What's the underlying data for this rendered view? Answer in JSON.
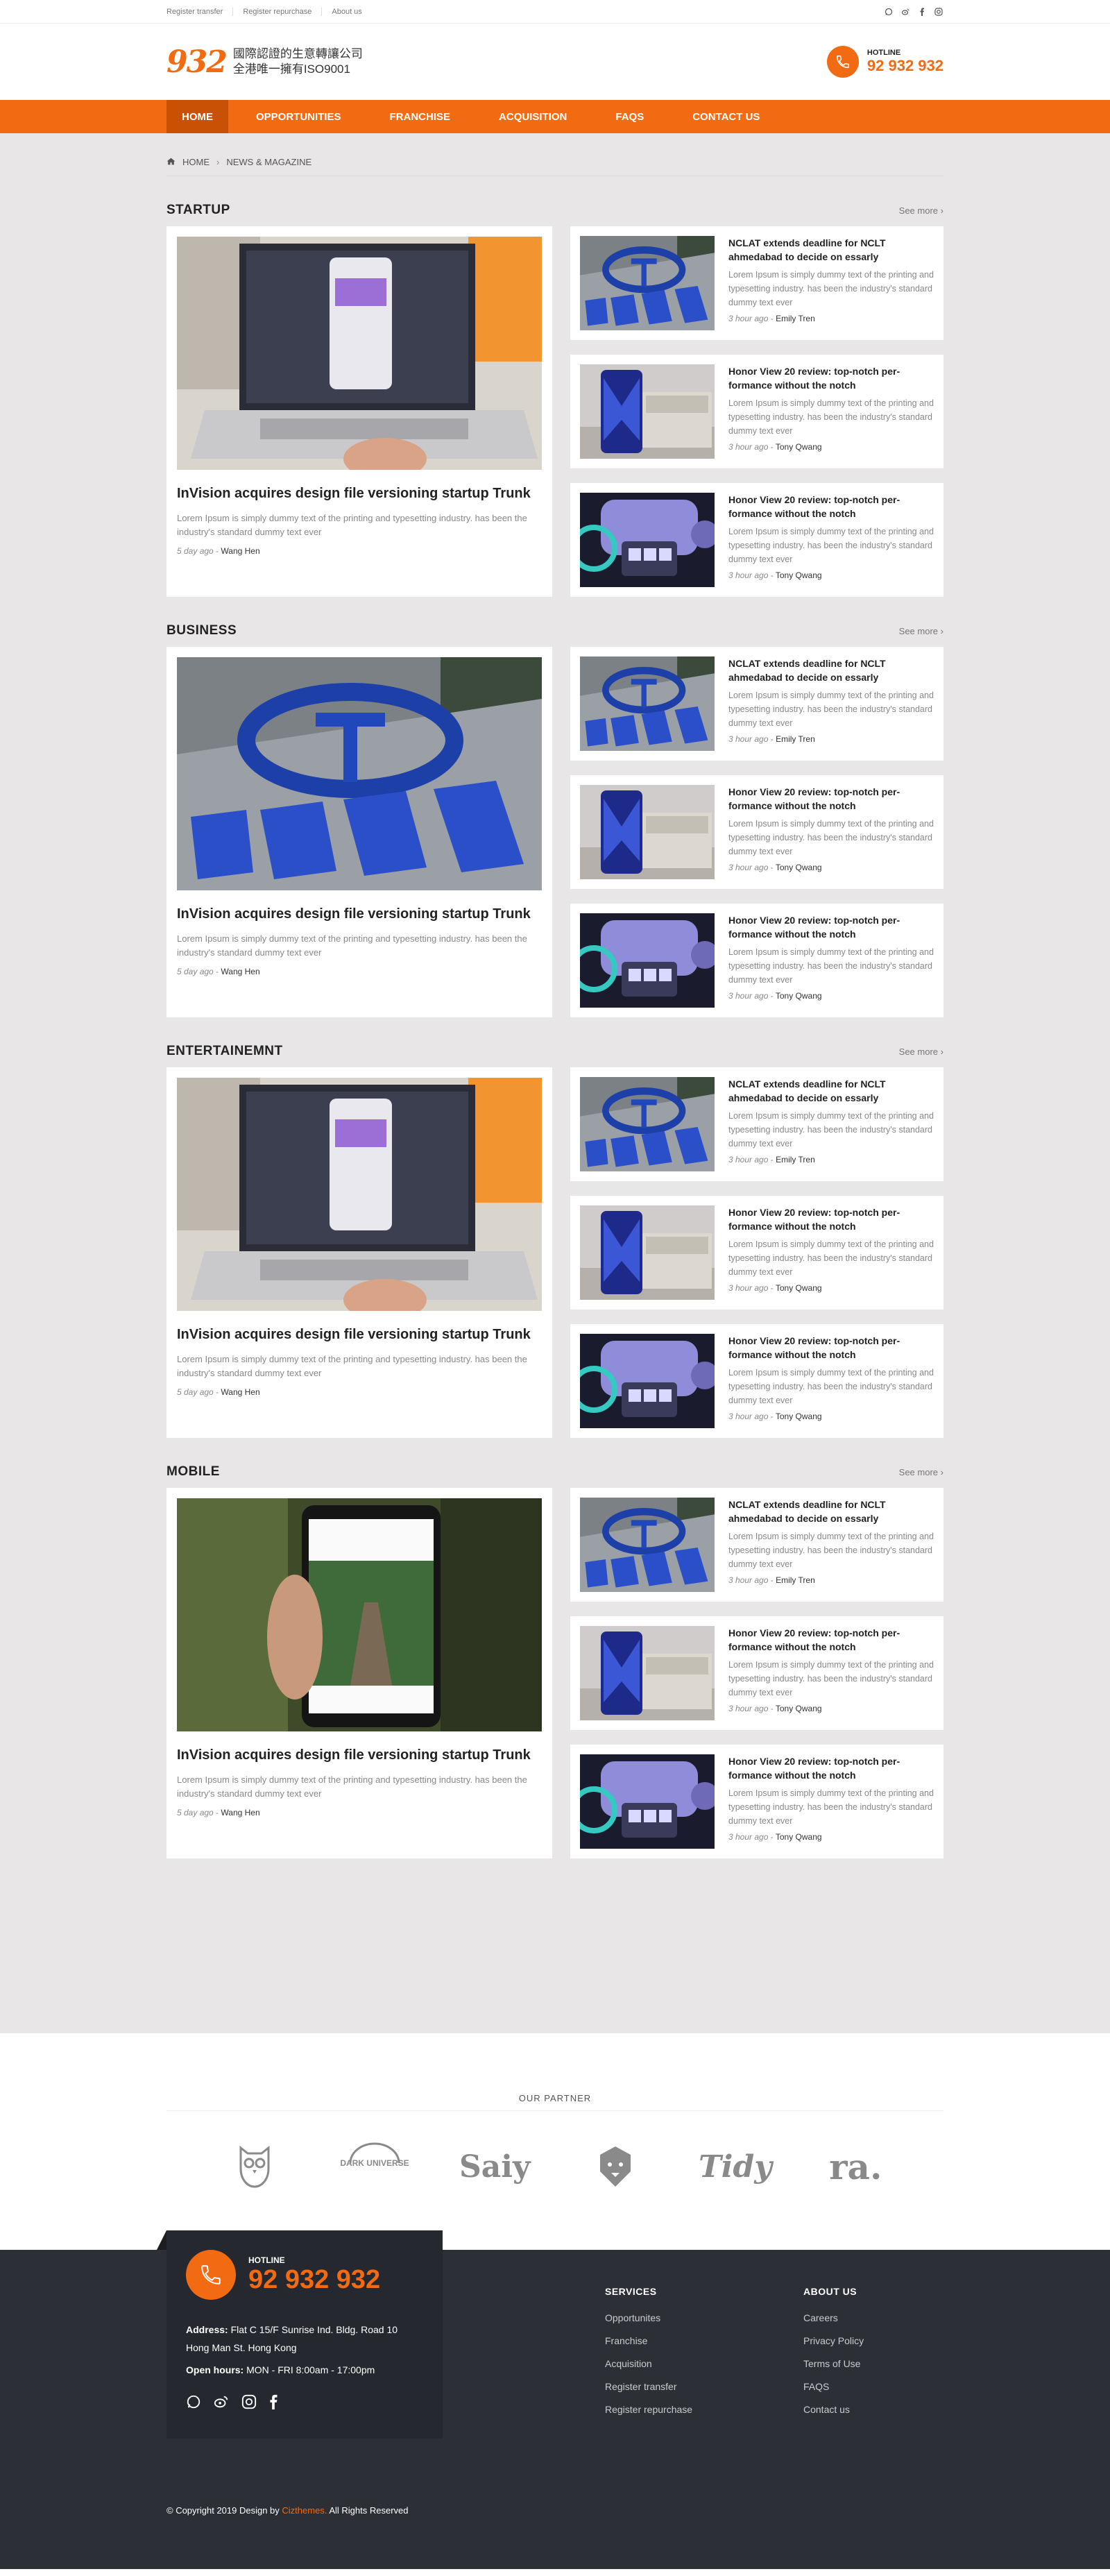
{
  "topbar": {
    "links": [
      "Register transfer",
      "Register repurchase",
      "About us"
    ],
    "social_icons": [
      "whatsapp-icon",
      "weibo-icon",
      "facebook-icon",
      "instagram-icon"
    ]
  },
  "header": {
    "logo_number": "932",
    "logo_line1": "國際認證的生意轉讓公司",
    "logo_line2": "全港唯一擁有ISO9001",
    "hotline_label": "HOTLINE",
    "hotline_number": "92 932 932"
  },
  "nav": {
    "items": [
      "HOME",
      "OPPORTUNITIES",
      "FRANCHISE",
      "ACQUISITION",
      "FAQS",
      "CONTACT US"
    ],
    "active": "HOME"
  },
  "breadcrumb": {
    "home": "HOME",
    "current": "NEWS & MAGAZINE"
  },
  "see_more": "See more",
  "sections": [
    {
      "title": "STARTUP",
      "feature": {
        "title": "InVision acquires design file versioning startup Trunk",
        "excerpt": "Lorem Ipsum is simply dummy text of the  printing and typesetting industry. has been the industry's standard dummy text ever",
        "ago": "5 day ago",
        "author": "Wang Hen",
        "image": "laptop"
      },
      "items": [
        {
          "title": "NCLAT extends deadline for NCLT ahmedabad to decide on essarly",
          "excerpt": "Lorem Ipsum is simply dummy text of the printing and typesetting industry. has been the industry's standard dummy text ever",
          "ago": "3 hour ago",
          "author": "Emily Tren",
          "image": "tata"
        },
        {
          "title": "Honor View 20 review: top-notch per-formance without the notch",
          "excerpt": "Lorem Ipsum is simply dummy text of the printing and typesetting industry. has been the industry's standard dummy text ever",
          "ago": "3 hour ago",
          "author": "Tony Qwang",
          "image": "phone"
        },
        {
          "title": "Honor View 20 review: top-notch per-formance without the notch",
          "excerpt": "Lorem Ipsum is simply dummy text of the printing and typesetting industry. has been the industry's standard dummy text ever",
          "ago": "3 hour ago",
          "author": "Tony Qwang",
          "image": "robot"
        }
      ]
    },
    {
      "title": "BUSINESS",
      "feature": {
        "title": "InVision acquires design file versioning startup Trunk",
        "excerpt": "Lorem Ipsum is simply dummy text of the  printing and typesetting industry. has been the industry's standard dummy text ever",
        "ago": "5 day ago",
        "author": "Wang Hen",
        "image": "tata"
      },
      "items": [
        {
          "title": "NCLAT extends deadline for NCLT ahmedabad to decide on essarly",
          "excerpt": "Lorem Ipsum is simply dummy text of the printing and typesetting industry. has been the industry's standard dummy text ever",
          "ago": "3 hour ago",
          "author": "Emily Tren",
          "image": "tata"
        },
        {
          "title": "Honor View 20 review: top-notch per-formance without the notch",
          "excerpt": "Lorem Ipsum is simply dummy text of the printing and typesetting industry. has been the industry's standard dummy text ever",
          "ago": "3 hour ago",
          "author": "Tony Qwang",
          "image": "phone"
        },
        {
          "title": "Honor View 20 review: top-notch per-formance without the notch",
          "excerpt": "Lorem Ipsum is simply dummy text of the printing and typesetting industry. has been the industry's standard dummy text ever",
          "ago": "3 hour ago",
          "author": "Tony Qwang",
          "image": "robot"
        }
      ]
    },
    {
      "title": "ENTERTAINEMNT",
      "feature": {
        "title": "InVision acquires design file versioning startup Trunk",
        "excerpt": "Lorem Ipsum is simply dummy text of the  printing and typesetting industry. has been the industry's standard dummy text ever",
        "ago": "5 day ago",
        "author": "Wang Hen",
        "image": "laptop"
      },
      "items": [
        {
          "title": "NCLAT extends deadline for NCLT ahmedabad to decide on essarly",
          "excerpt": "Lorem Ipsum is simply dummy text of the printing and typesetting industry. has been the industry's standard dummy text ever",
          "ago": "3 hour ago",
          "author": "Emily Tren",
          "image": "tata"
        },
        {
          "title": "Honor View 20 review: top-notch per-formance without the notch",
          "excerpt": "Lorem Ipsum is simply dummy text of the printing and typesetting industry. has been the industry's standard dummy text ever",
          "ago": "3 hour ago",
          "author": "Tony Qwang",
          "image": "phone"
        },
        {
          "title": "Honor View 20 review: top-notch per-formance without the notch",
          "excerpt": "Lorem Ipsum is simply dummy text of the printing and typesetting industry. has been the industry's standard dummy text ever",
          "ago": "3 hour ago",
          "author": "Tony Qwang",
          "image": "robot"
        }
      ]
    },
    {
      "title": "MOBILE",
      "feature": {
        "title": "InVision acquires design file versioning startup Trunk",
        "excerpt": "Lorem Ipsum is simply dummy text of the  printing and typesetting industry. has been the industry's standard dummy text ever",
        "ago": "5 day ago",
        "author": "Wang Hen",
        "image": "handphone"
      },
      "items": [
        {
          "title": "NCLAT extends deadline for NCLT ahmedabad to decide on essarly",
          "excerpt": "Lorem Ipsum is simply dummy text of the printing and typesetting industry. has been the industry's standard dummy text ever",
          "ago": "3 hour ago",
          "author": "Emily Tren",
          "image": "tata"
        },
        {
          "title": "Honor View 20 review: top-notch per-formance without the notch",
          "excerpt": "Lorem Ipsum is simply dummy text of the printing and typesetting industry. has been the industry's standard dummy text ever",
          "ago": "3 hour ago",
          "author": "Tony Qwang",
          "image": "phone"
        },
        {
          "title": "Honor View 20 review: top-notch per-formance without the notch",
          "excerpt": "Lorem Ipsum is simply dummy text of the printing and typesetting industry. has been the industry's standard dummy text ever",
          "ago": "3 hour ago",
          "author": "Tony Qwang",
          "image": "robot"
        }
      ]
    }
  ],
  "partners": {
    "title": "OUR PARTNER",
    "logos": [
      "owl-logo",
      "DARK UNIVERSE",
      "Saiy",
      "lion-logo",
      "Tidy",
      "ra."
    ]
  },
  "footer": {
    "hotline_label": "HOTLINE",
    "hotline_number": "92 932 932",
    "address_label": "Address:",
    "address": "Flat C 15/F Sunrise Ind. Bldg.  Road 10 Hong Man St. Hong Kong",
    "hours_label": "Open hours:",
    "hours": "MON - FRI  8:00am - 17:00pm",
    "services_title": "SERVICES",
    "services": [
      "Opportunites",
      "Franchise",
      "Acquisition",
      "Register transfer",
      "Register repurchase"
    ],
    "about_title": "ABOUT US",
    "about": [
      "Careers",
      "Privacy Policy",
      "Terms of Use",
      "FAQS",
      "Contact us"
    ],
    "copyright_pre": "© Copyright 2019 Design by",
    "copyright_brand": "Cizthemes.",
    "copyright_post": "All Rights Reserved"
  },
  "colors": {
    "accent": "#f26b12",
    "nav_active": "#c85105",
    "footer_bg": "#2c2f35",
    "page_bg": "#e8e6e6"
  }
}
